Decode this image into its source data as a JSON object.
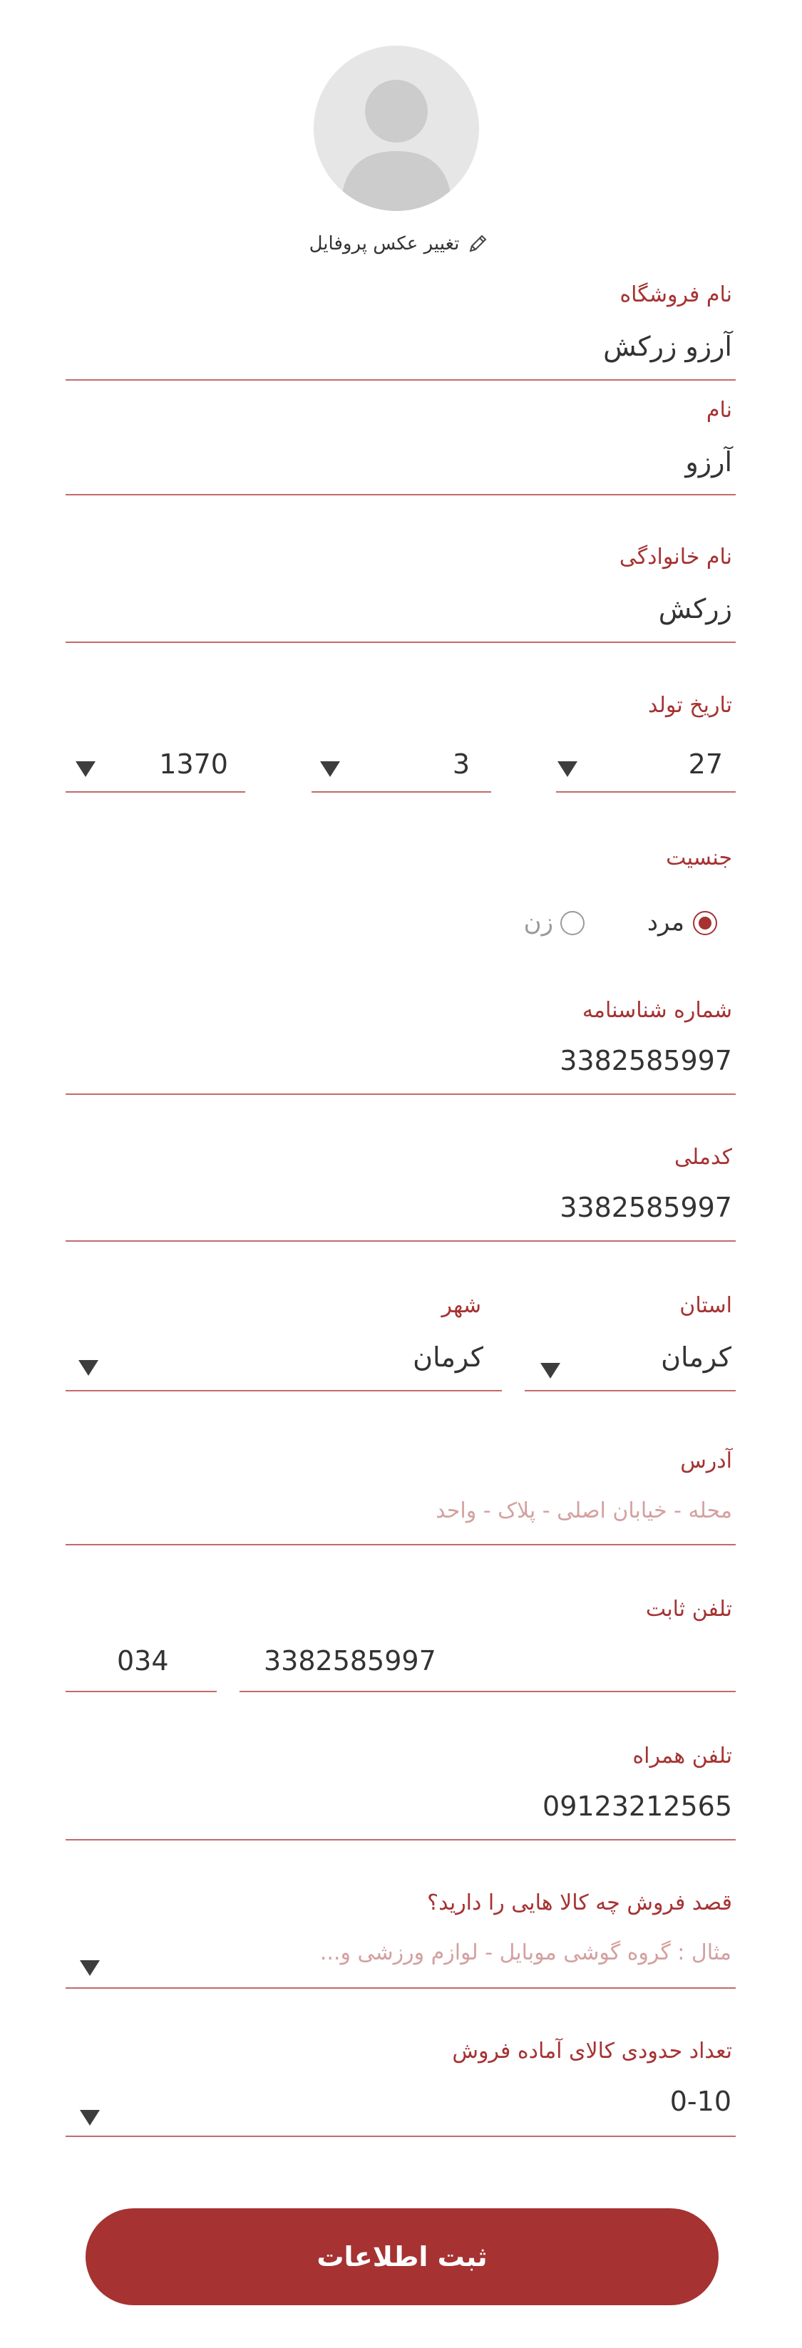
{
  "profile": {
    "change_photo_label": "تغییر عکس پروفایل",
    "icons": {
      "avatar": "person-silhouette",
      "edit": "pencil-icon"
    }
  },
  "fields": {
    "store_name": {
      "label": "نام فروشگاه",
      "value": "آرزو زرکش"
    },
    "first_name": {
      "label": "نام",
      "value": "آرزو"
    },
    "last_name": {
      "label": "نام خانوادگی",
      "value": "زرکش"
    },
    "birth_date": {
      "label": "تاریخ تولد",
      "day": "27",
      "month": "3",
      "year": "1370"
    },
    "gender": {
      "label": "جنسیت",
      "options": [
        "مرد",
        "زن"
      ],
      "selected": "مرد"
    },
    "id_number": {
      "label": "شماره شناسنامه",
      "value": "3382585997"
    },
    "national_code": {
      "label": "کدملی",
      "value": "3382585997"
    },
    "province": {
      "label": "استان",
      "value": "کرمان"
    },
    "city": {
      "label": "شهر",
      "value": "کرمان"
    },
    "address": {
      "label": "آدرس",
      "placeholder": "محله - خیابان اصلی - پلاک - واحد"
    },
    "landline": {
      "label": "تلفن ثابت",
      "number": "3382585997",
      "area_code": "034"
    },
    "mobile": {
      "label": "تلفن همراه",
      "value": "09123212565"
    },
    "goods": {
      "label": "قصد فروش چه کالا هایی را دارید؟",
      "placeholder": "مثال : گروه گوشی موبایل - لوازم ورزشی و..."
    },
    "quantity": {
      "label": "تعداد حدودی کالای آماده فروش",
      "value": "0-10"
    }
  },
  "submit_label": "ثبت اطلاعات",
  "colors": {
    "accent": "#a63232",
    "underline": "#c46a6a",
    "text": "#333333",
    "placeholder": "#d4a0a0",
    "avatar_bg": "#e6e6e6"
  }
}
